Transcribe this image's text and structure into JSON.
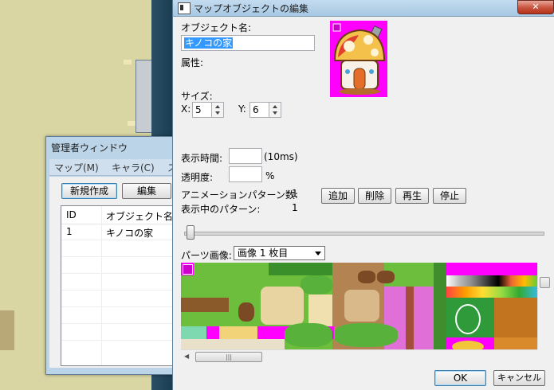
{
  "admin": {
    "title": "管理者ウィンドウ",
    "menu": [
      "マップ(M)",
      "キャラ(C)",
      "ス"
    ],
    "buttons": {
      "new": "新規作成",
      "edit": "編集"
    },
    "columns": [
      "ID",
      "オブジェクト名"
    ],
    "rows": [
      {
        "id": "1",
        "name": "キノコの家"
      }
    ]
  },
  "dialog": {
    "title": "マップオブジェクトの編集",
    "close_label": "✕",
    "object_name_label": "オブジェクト名:",
    "object_name_value": "キノコの家",
    "attribute_label": "属性:",
    "size_label": "サイズ:",
    "x_label": "X:",
    "x_value": "5",
    "y_label": "Y:",
    "y_value": "6",
    "display_time_label": "表示時間:",
    "display_time_value": "",
    "display_time_unit": "(10ms)",
    "opacity_label": "透明度:",
    "opacity_value": "",
    "opacity_unit": "%",
    "anim_count_label": "アニメーションパターン数:",
    "anim_count_value": "1",
    "current_pattern_label": "表示中のパターン:",
    "current_pattern_value": "1",
    "buttons": {
      "add": "追加",
      "delete": "削除",
      "play": "再生",
      "stop": "停止"
    },
    "parts_label": "パーツ画像:",
    "parts_select": "画像 1 枚目",
    "hscroll_grip": "|||",
    "ok": "OK",
    "cancel": "キャンセル"
  },
  "colors": {
    "magenta": "#ff00ff",
    "grass": "#6cbe3c",
    "title_bar": "#b4d0e8"
  }
}
